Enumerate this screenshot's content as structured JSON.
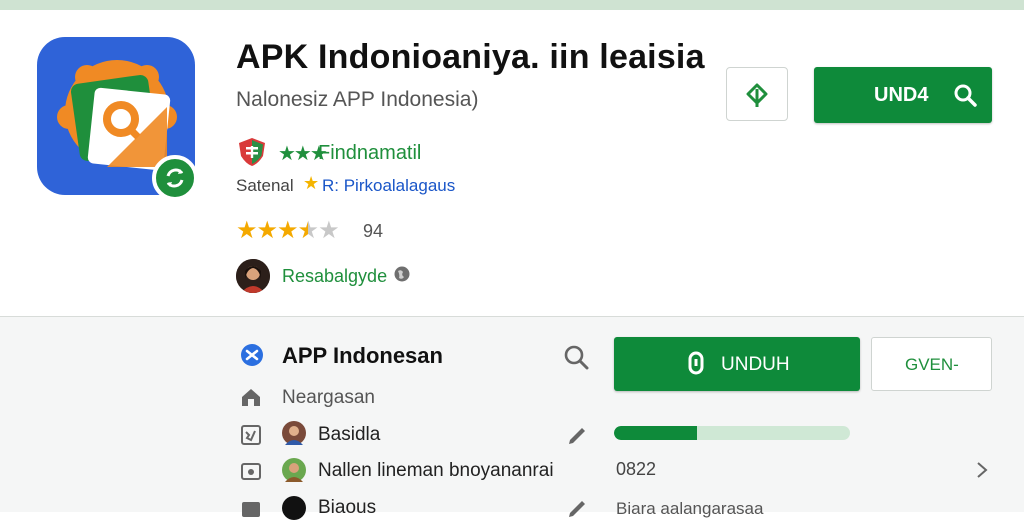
{
  "app": {
    "title": "APK Indonioaniya. iin leaisia",
    "subtitle": "Nalonesiz APP Indonesia)",
    "badge_text": "Findnamatil",
    "satisfaction_label": "Satenal",
    "satisfaction_text": "R: Pirkoalalagaus",
    "rating": 3.5,
    "rating_count": "94",
    "developer": "Resabalgyde",
    "download_button_label": "UND4"
  },
  "lower": {
    "title": "APP Indonesan",
    "category": "Neargasan",
    "user1": "Basidla",
    "user2": "Nallen lineman bnoyananrai",
    "user3": "Biaous",
    "unduh_label": "UNDUH",
    "open_label": "GVEN-",
    "progress": 0.35,
    "version": "0822",
    "footer_text": "Biara aalangarasaa"
  },
  "colors": {
    "accent": "#0e8a3a",
    "brand_blue": "#2f63d8",
    "star": "#f4a900",
    "progress_track": "#cfe8d5"
  },
  "icons": [
    "app-logo-icon",
    "sync-badge-icon",
    "share-icon",
    "search-icon",
    "shield-icon",
    "star-icon",
    "globe-icon",
    "blue-x-icon",
    "home-icon",
    "gallery-icon",
    "camera-icon",
    "pen-icon",
    "download-icon",
    "chevron-right-icon"
  ]
}
